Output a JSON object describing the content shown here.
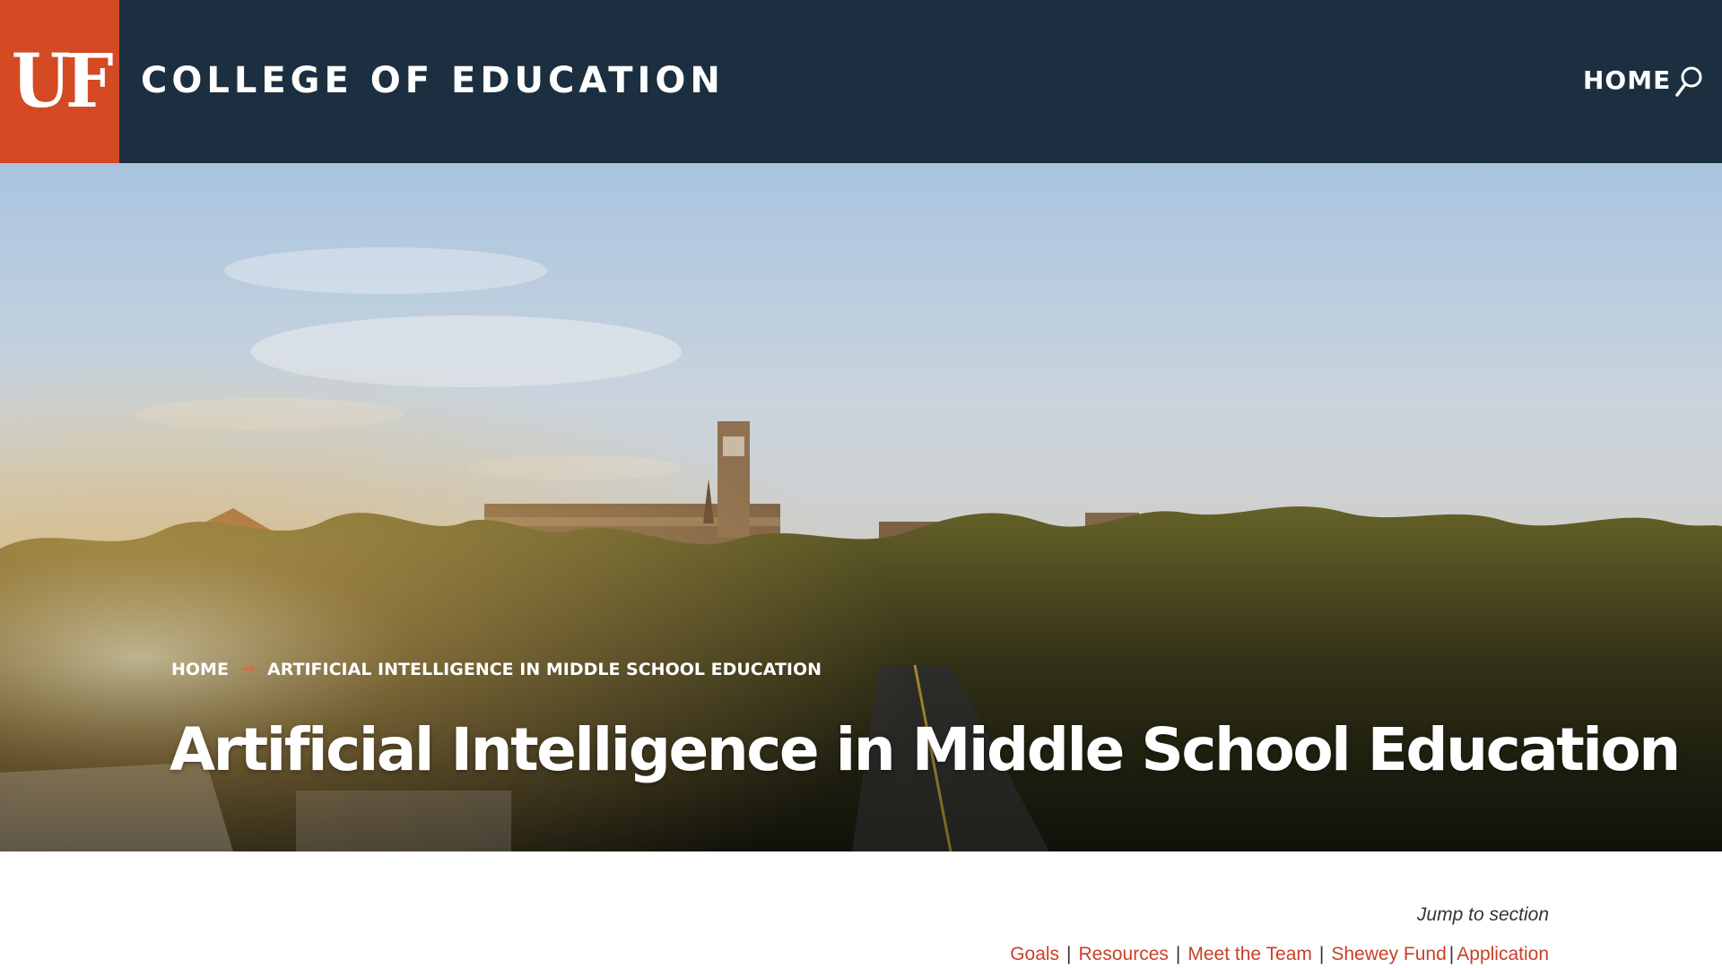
{
  "header": {
    "logo_text": "UF",
    "site_title": "COLLEGE OF EDUCATION",
    "nav": [
      {
        "label": "HOME"
      }
    ],
    "search_icon": "search-icon"
  },
  "hero": {
    "breadcrumb": {
      "home": "HOME",
      "separator": "→",
      "current": "ARTIFICIAL INTELLIGENCE IN MIDDLE SCHOOL EDUCATION"
    },
    "title": "Artificial Intelligence in Middle School Education"
  },
  "jump": {
    "label": "Jump to section",
    "separator": "|",
    "links": [
      {
        "label": "Goals"
      },
      {
        "label": "Resources"
      },
      {
        "label": "Meet the Team"
      },
      {
        "label": "Shewey Fund"
      },
      {
        "label": "Application"
      }
    ]
  },
  "colors": {
    "header_bg": "#1c2f40",
    "logo_bg": "#d44a23",
    "link": "#c8402a",
    "breadcrumb_arrow": "#e8663a"
  }
}
